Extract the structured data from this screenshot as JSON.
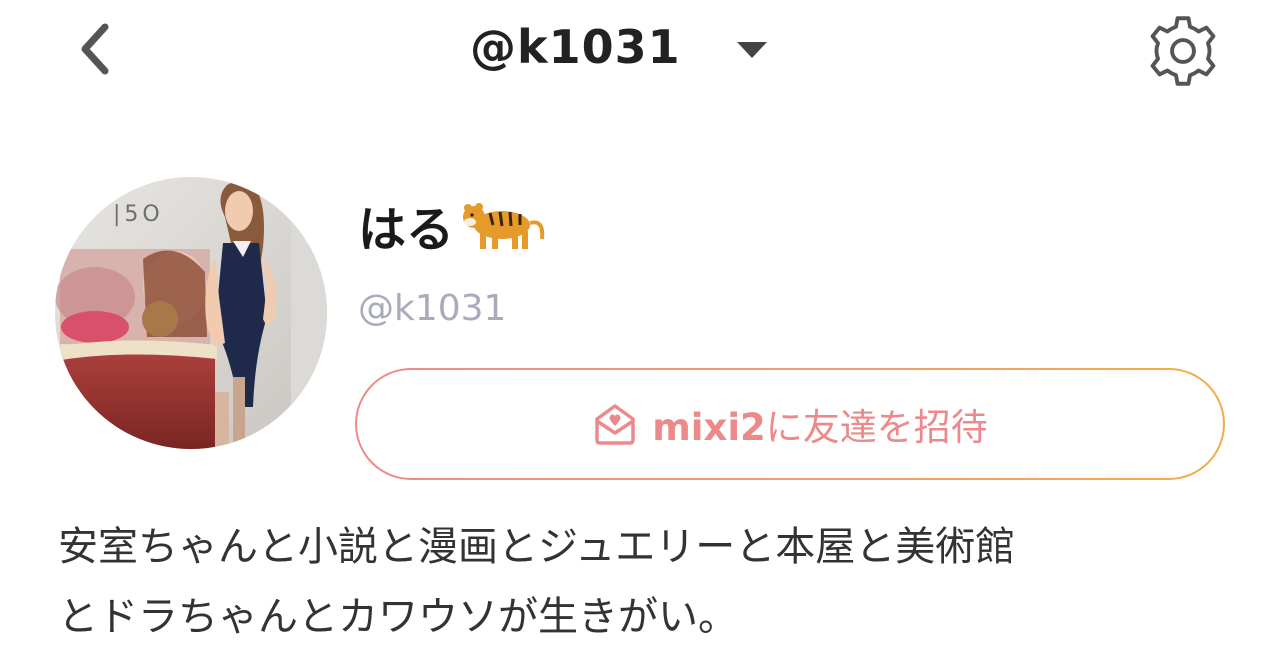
{
  "header": {
    "title": "@k1031",
    "back_icon": "chevron-left-icon",
    "dropdown_icon": "caret-down-icon",
    "settings_icon": "gear-icon"
  },
  "profile": {
    "display_name": "はる",
    "display_name_emoji": "tiger-emoji",
    "handle": "@k1031",
    "avatar": "profile-photo"
  },
  "invite": {
    "icon": "envelope-heart-icon",
    "brand": "mixi2",
    "label_rest": "に友達を招待",
    "color": "#ec8a8b"
  },
  "bio": {
    "text": "安室ちゃんと小説と漫画とジュエリーと本屋と美術館\nとドラちゃんとカワウソが生きがい。"
  }
}
